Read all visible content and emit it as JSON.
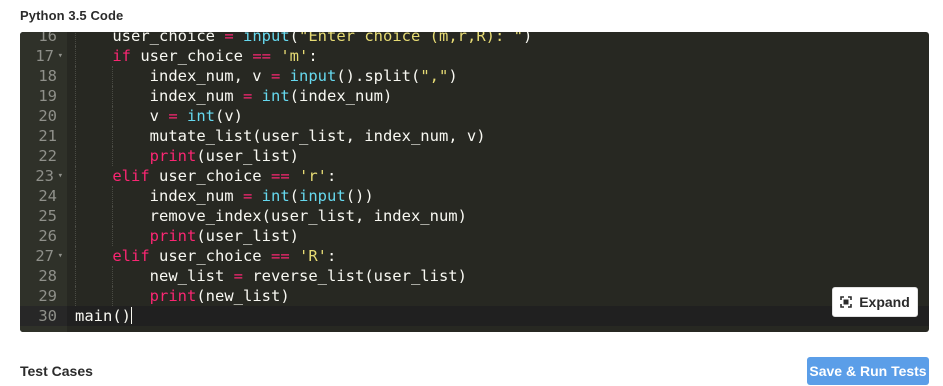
{
  "header": {
    "title": "Python 3.5 Code"
  },
  "editor": {
    "lines": [
      {
        "n": "16",
        "fold": false
      },
      {
        "n": "17",
        "fold": true
      },
      {
        "n": "18",
        "fold": false
      },
      {
        "n": "19",
        "fold": false
      },
      {
        "n": "20",
        "fold": false
      },
      {
        "n": "21",
        "fold": false
      },
      {
        "n": "22",
        "fold": false
      },
      {
        "n": "23",
        "fold": true
      },
      {
        "n": "24",
        "fold": false
      },
      {
        "n": "25",
        "fold": false
      },
      {
        "n": "26",
        "fold": false
      },
      {
        "n": "27",
        "fold": true
      },
      {
        "n": "28",
        "fold": false
      },
      {
        "n": "29",
        "fold": false
      },
      {
        "n": "30",
        "fold": false
      }
    ],
    "code": {
      "l16": {
        "a": "user_choice ",
        "b": "=",
        "c": " ",
        "d": "input",
        "e": "(",
        "f": "\"Enter choice (m,r,R): \"",
        "g": ")"
      },
      "l17": {
        "a": "if",
        "b": " user_choice ",
        "c": "==",
        "d": " ",
        "e": "'m'",
        "f": ":"
      },
      "l18": {
        "a": "index_num, v ",
        "b": "=",
        "c": " ",
        "d": "input",
        "e": "().split(",
        "f": "\",\"",
        "g": ")"
      },
      "l19": {
        "a": "index_num ",
        "b": "=",
        "c": " ",
        "d": "int",
        "e": "(index_num)"
      },
      "l20": {
        "a": "v ",
        "b": "=",
        "c": " ",
        "d": "int",
        "e": "(v)"
      },
      "l21": {
        "a": "mutate_list(user_list, index_num, v)"
      },
      "l22": {
        "a": "print",
        "b": "(user_list)"
      },
      "l23": {
        "a": "elif",
        "b": " user_choice ",
        "c": "==",
        "d": " ",
        "e": "'r'",
        "f": ":"
      },
      "l24": {
        "a": "index_num ",
        "b": "=",
        "c": " ",
        "d": "int",
        "e": "(",
        "f": "input",
        "g": "())"
      },
      "l25": {
        "a": "remove_index(user_list, index_num)"
      },
      "l26": {
        "a": "print",
        "b": "(user_list)"
      },
      "l27": {
        "a": "elif",
        "b": " user_choice ",
        "c": "==",
        "d": " ",
        "e": "'R'",
        "f": ":"
      },
      "l28": {
        "a": "new_list ",
        "b": "=",
        "c": " reverse_list(user_list)"
      },
      "l29": {
        "a": "print",
        "b": "(new_list)"
      },
      "l30": {
        "a": "main()"
      }
    },
    "fold_glyph": "▾",
    "expand_label": "Expand"
  },
  "footer": {
    "title": "Test Cases",
    "run_label": "Save & Run Tests"
  },
  "colors": {
    "editor_bg": "#272822",
    "keyword": "#f92672",
    "builtin": "#66d9ef",
    "string": "#e6db74",
    "run_button": "#5b9ee8"
  }
}
